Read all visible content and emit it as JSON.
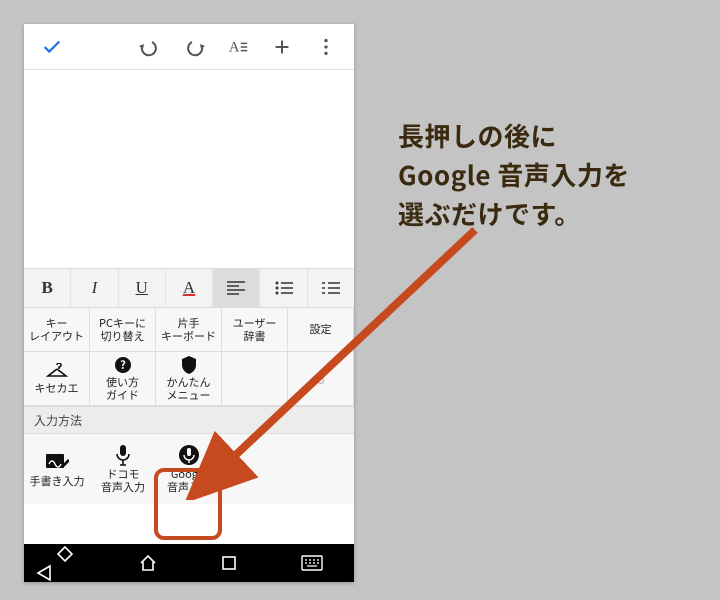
{
  "annotation": {
    "line1": "長押しの後に",
    "line2": "Google 音声入力を",
    "line3": "選ぶだけです。"
  },
  "fmt": {
    "bold": "B",
    "italic": "I",
    "underline": "U",
    "color": "A"
  },
  "ime": {
    "row1": {
      "key_layout": "キー\nレイアウト",
      "pc_key": "PCキーに\n切り替え",
      "one_hand": "片手\nキーボード",
      "user_dict": "ユーザー\n辞書",
      "settings": "設定"
    },
    "row2": {
      "kisekae": "キセカエ",
      "guide": "使い方\nガイド",
      "easy_menu": "かんたん\nメニュー",
      "num6": "6"
    },
    "header": "入力方法",
    "methods": {
      "handwriting": "手書き入力",
      "docomo_voice": "ドコモ\n音声入力",
      "google_voice": "Google\n音声入力"
    }
  }
}
